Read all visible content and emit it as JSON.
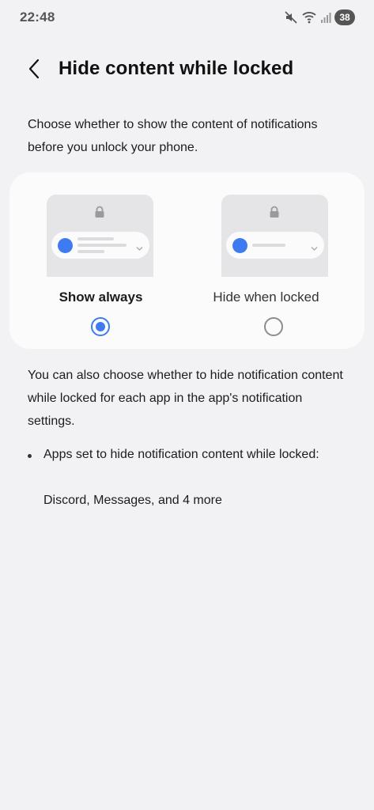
{
  "status_bar": {
    "time": "22:48",
    "battery": "38",
    "icons": [
      "mute-icon",
      "wifi-icon",
      "signal-icon"
    ]
  },
  "header": {
    "back_icon": "chevron-left-icon",
    "title": "Hide content while locked"
  },
  "description": "Choose whether to show the content of notifications before you unlock your phone.",
  "options": [
    {
      "label": "Show always",
      "selected": true
    },
    {
      "label": "Hide when locked",
      "selected": false
    }
  ],
  "info_text": "You can also choose whether to hide notification content while locked for each app in the app's notification settings.",
  "bullet": {
    "text": "Apps set to hide notification content while locked:",
    "apps": "Discord, Messages, and 4 more"
  },
  "colors": {
    "accent": "#3e7bf0",
    "background": "#f2f2f4",
    "card": "#fbfbfc"
  }
}
